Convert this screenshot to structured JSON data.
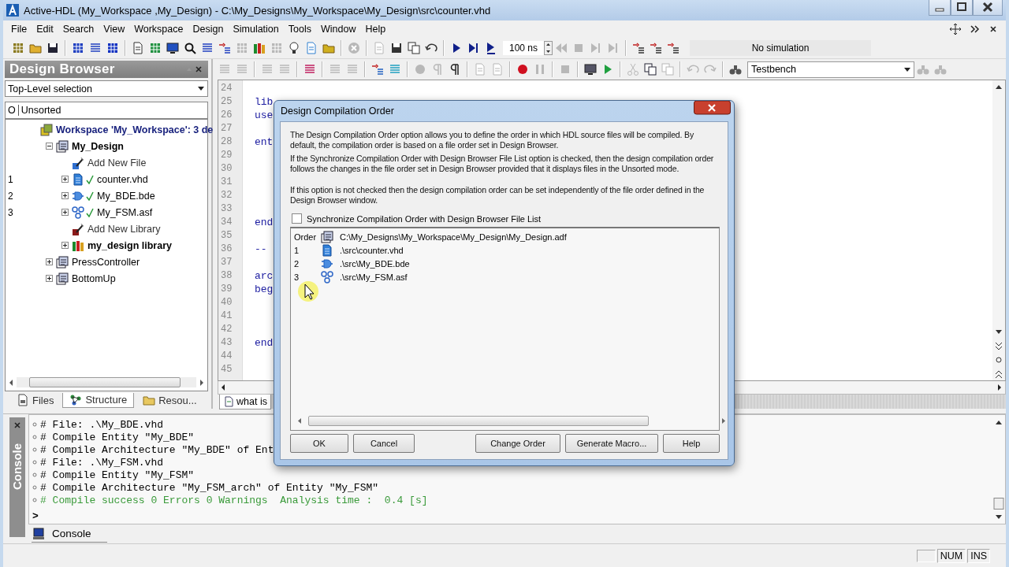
{
  "window": {
    "title": "Active-HDL (My_Workspace ,My_Design) - C:\\My_Designs\\My_Workspace\\My_Design\\src\\counter.vhd"
  },
  "menu": [
    "File",
    "Edit",
    "Search",
    "View",
    "Workspace",
    "Design",
    "Simulation",
    "Tools",
    "Window",
    "Help"
  ],
  "toolbar": {
    "time_field": "100 ns",
    "status_field": "No simulation",
    "target_dropdown": "Testbench"
  },
  "design_browser": {
    "title": "Design Browser",
    "top_level_combo": "Top-Level selection",
    "tree_header": {
      "column_1": "O",
      "column_2": "Unsorted"
    },
    "tree": [
      {
        "label": "Workspace 'My_Workspace': 3 de",
        "kind": "workspace",
        "children": [
          {
            "label": "My_Design",
            "kind": "design",
            "active": true,
            "expanded": true,
            "children": [
              {
                "label": "Add New File",
                "kind": "add_file"
              },
              {
                "label": "counter.vhd",
                "kind": "vhd",
                "order": "1",
                "compiled": true,
                "expanded": false
              },
              {
                "label": "My_BDE.bde",
                "kind": "bde",
                "order": "2",
                "compiled": true,
                "expanded": false
              },
              {
                "label": "My_FSM.asf",
                "kind": "fsm",
                "order": "3",
                "compiled": true,
                "expanded": false
              },
              {
                "label": "Add New Library",
                "kind": "add_library"
              },
              {
                "label": "my_design library",
                "kind": "library",
                "expanded": false
              }
            ]
          },
          {
            "label": "PressController",
            "kind": "design",
            "active": false,
            "expanded": false
          },
          {
            "label": "BottomUp",
            "kind": "design",
            "active": false,
            "expanded": false
          }
        ]
      }
    ],
    "tabs": [
      {
        "label": "Files",
        "selected": false
      },
      {
        "label": "Structure",
        "selected": true
      },
      {
        "label": "Resou...",
        "selected": false
      }
    ]
  },
  "editor": {
    "lines": [
      {
        "number": "24"
      },
      {
        "number": "25",
        "code": "lib"
      },
      {
        "number": "26",
        "code": "use"
      },
      {
        "number": "27"
      },
      {
        "number": "28",
        "code": "ent"
      },
      {
        "number": "29"
      },
      {
        "number": "30"
      },
      {
        "number": "31"
      },
      {
        "number": "32"
      },
      {
        "number": "33"
      },
      {
        "number": "34",
        "code": "end"
      },
      {
        "number": "35"
      },
      {
        "number": "36",
        "code": "--"
      },
      {
        "number": "37"
      },
      {
        "number": "38",
        "code": "arc"
      },
      {
        "number": "39",
        "code": "beg"
      },
      {
        "number": "40"
      },
      {
        "number": "41"
      },
      {
        "number": "42"
      },
      {
        "number": "43",
        "code": "end"
      },
      {
        "number": "44"
      },
      {
        "number": "45"
      }
    ],
    "tab": "what is"
  },
  "console": {
    "side_label": "Console",
    "lines": [
      {
        "text": "# File: .\\My_BDE.vhd",
        "kind": "info"
      },
      {
        "text": "# Compile Entity \"My_BDE\"",
        "kind": "info"
      },
      {
        "text": "# Compile Architecture \"My_BDE\" of Ent",
        "kind": "info"
      },
      {
        "text": "# File: .\\My_FSM.vhd",
        "kind": "info"
      },
      {
        "text": "# Compile Entity \"My_FSM\"",
        "kind": "info"
      },
      {
        "text": "# Compile Architecture \"My_FSM_arch\" of Entity \"My_FSM\"",
        "kind": "info"
      },
      {
        "text": "# Compile success 0 Errors 0 Warnings  Analysis time :  0.4 [s]",
        "kind": "success"
      }
    ],
    "prompt": ">",
    "tab": "Console"
  },
  "status_bar": [
    "NUM",
    "INS"
  ],
  "dialog": {
    "title": "Design Compilation Order",
    "paragraphs": [
      "The Design Compilation Order option allows you to define the order in which HDL source files will be compiled. By default, the compilation order is based on a file order set in Design Browser.",
      "If the Synchronize Compilation Order with Design Browser File List option is checked, then the design compilation order follows the changes in the file order set in Design Browser provided that it displays files in the Unsorted mode.",
      "If this option is not checked then the design compilation order can be set independently of the file order defined in the Design Browser window."
    ],
    "sync_checkbox": {
      "label": "Synchronize Compilation Order with Design Browser File List",
      "checked": false
    },
    "list_header": {
      "column_1": "Order",
      "path": "C:\\My_Designs\\My_Workspace\\My_Design\\My_Design.adf"
    },
    "rows": [
      {
        "order": "1",
        "kind": "vhd",
        "path": ".\\src\\counter.vhd"
      },
      {
        "order": "2",
        "kind": "bde",
        "path": ".\\src\\My_BDE.bde"
      },
      {
        "order": "3",
        "kind": "fsm",
        "path": ".\\src\\My_FSM.asf"
      }
    ],
    "buttons": [
      "OK",
      "Cancel",
      "Change Order",
      "Generate Macro...",
      "Help"
    ]
  }
}
